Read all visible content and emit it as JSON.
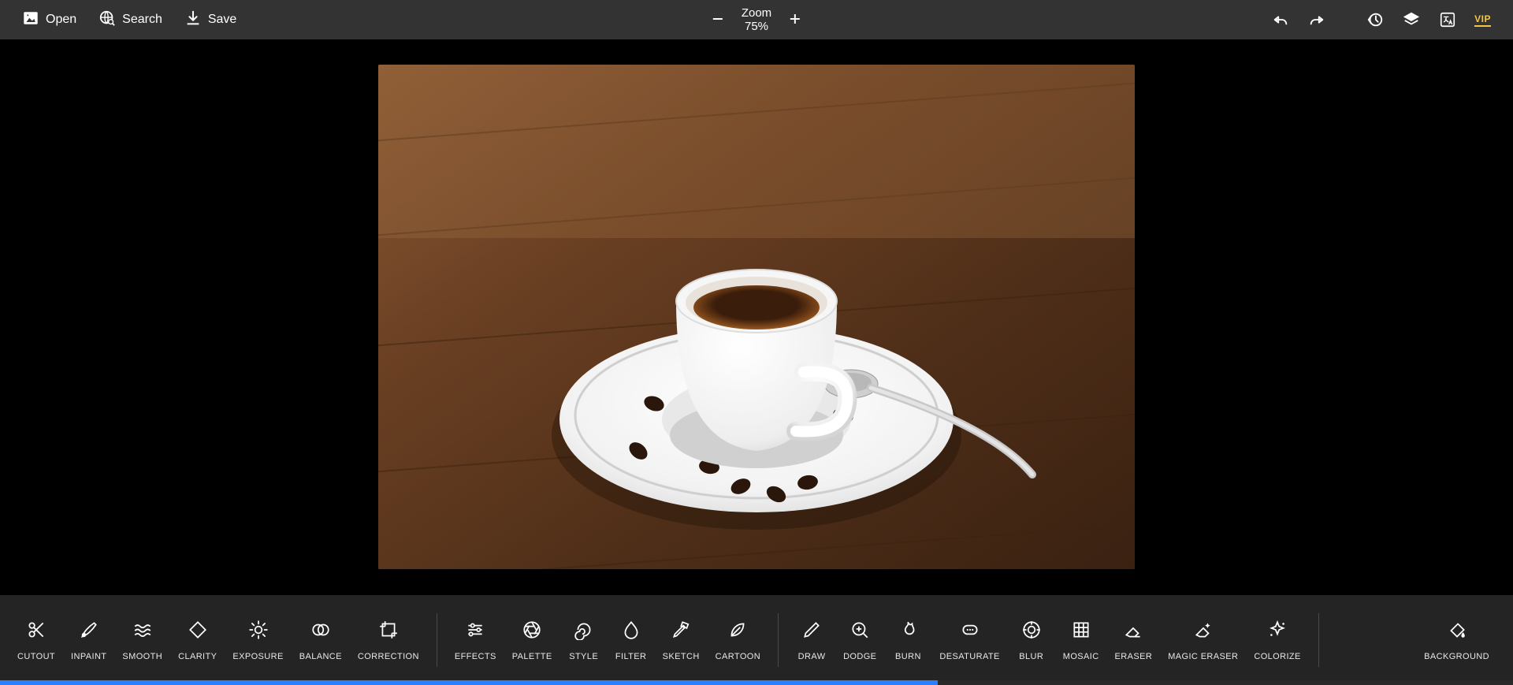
{
  "topbar": {
    "open": "Open",
    "search": "Search",
    "save": "Save",
    "zoom_label": "Zoom",
    "zoom_value": "75%",
    "vip": "VIP"
  },
  "tools_group1": [
    {
      "id": "cutout",
      "label": "CUTOUT",
      "icon": "scissors"
    },
    {
      "id": "inpaint",
      "label": "INPAINT",
      "icon": "brush"
    },
    {
      "id": "smooth",
      "label": "SMOOTH",
      "icon": "waves"
    },
    {
      "id": "clarity",
      "label": "CLARITY",
      "icon": "diamond"
    },
    {
      "id": "exposure",
      "label": "EXPOSURE",
      "icon": "sun"
    },
    {
      "id": "balance",
      "label": "BALANCE",
      "icon": "overlap"
    },
    {
      "id": "correction",
      "label": "CORRECTION",
      "icon": "crop-frame"
    }
  ],
  "tools_group2": [
    {
      "id": "effects",
      "label": "EFFECTS",
      "icon": "sliders"
    },
    {
      "id": "palette",
      "label": "PALETTE",
      "icon": "aperture"
    },
    {
      "id": "style",
      "label": "STYLE",
      "icon": "swirl"
    },
    {
      "id": "filter",
      "label": "FILTER",
      "icon": "drop"
    },
    {
      "id": "sketch",
      "label": "SKETCH",
      "icon": "pencil-ruler"
    },
    {
      "id": "cartoon",
      "label": "CARTOON",
      "icon": "leaf"
    }
  ],
  "tools_group3": [
    {
      "id": "draw",
      "label": "DRAW",
      "icon": "pencil"
    },
    {
      "id": "dodge",
      "label": "DODGE",
      "icon": "magnify-plus"
    },
    {
      "id": "burn",
      "label": "BURN",
      "icon": "flame"
    },
    {
      "id": "desaturate",
      "label": "DESATURATE",
      "icon": "rounded-rect"
    },
    {
      "id": "blur",
      "label": "BLUR",
      "icon": "target"
    },
    {
      "id": "mosaic",
      "label": "MOSAIC",
      "icon": "grid"
    },
    {
      "id": "eraser",
      "label": "ERASER",
      "icon": "eraser"
    },
    {
      "id": "magic-eraser",
      "label": "MAGIC ERASER",
      "icon": "sparkle-eraser"
    },
    {
      "id": "colorize",
      "label": "COLORIZE",
      "icon": "sparkle"
    }
  ],
  "tools_group4": [
    {
      "id": "background",
      "label": "BACKGROUND",
      "icon": "paint-bucket"
    }
  ],
  "progress_percent": 62
}
